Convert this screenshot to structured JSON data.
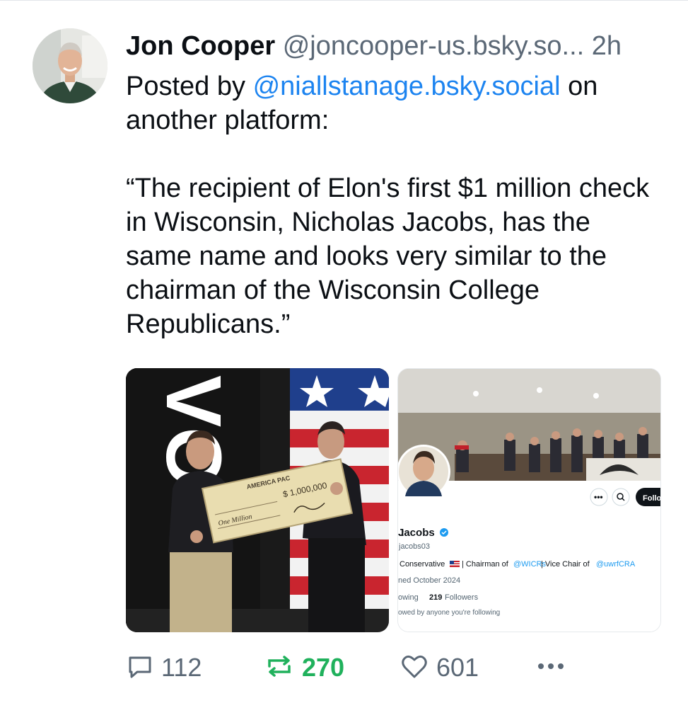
{
  "post": {
    "author_name": "Jon Cooper",
    "author_handle": "@joncooper-us.bsky.so...",
    "time": "2h",
    "posted_by_prefix": "Posted by",
    "posted_by_handle": "@niallstanage.bsky.social",
    "posted_by_suffix": "on another platform:",
    "quote": "“The recipient of Elon's first $1 million check in Wisconsin, Nicholas Jacobs, has the same name and looks very similar to the chairman of the Wisconsin College Republicans.”"
  },
  "image_left": {
    "banner_text": "VO",
    "check_org": "AMERICA PAC",
    "check_amount": "$ 1,000,000",
    "check_written": "One Million"
  },
  "image_right": {
    "profile_name": "Jacobs",
    "profile_handle": "jacobs03",
    "bio_prefix": "Conservative",
    "bio_chairman": "| Chairman of",
    "bio_mention1": "@WICRs",
    "bio_vice": "| Vice Chair of",
    "bio_mention2": "@uwrfCRA",
    "joined": "ned October 2024",
    "following_label": "owing",
    "followers_count": "219",
    "followers_label": "Followers",
    "followed_by": "owed by anyone you're following",
    "follow_button": "Follo"
  },
  "actions": {
    "replies": "112",
    "reposts": "270",
    "likes": "601"
  },
  "colors": {
    "link": "#1d84f0",
    "repost_active": "#20b15c",
    "muted": "#5b6876"
  },
  "icons": [
    "reply-icon",
    "repost-icon",
    "like-icon",
    "more-icon",
    "verified-icon",
    "search-icon"
  ]
}
